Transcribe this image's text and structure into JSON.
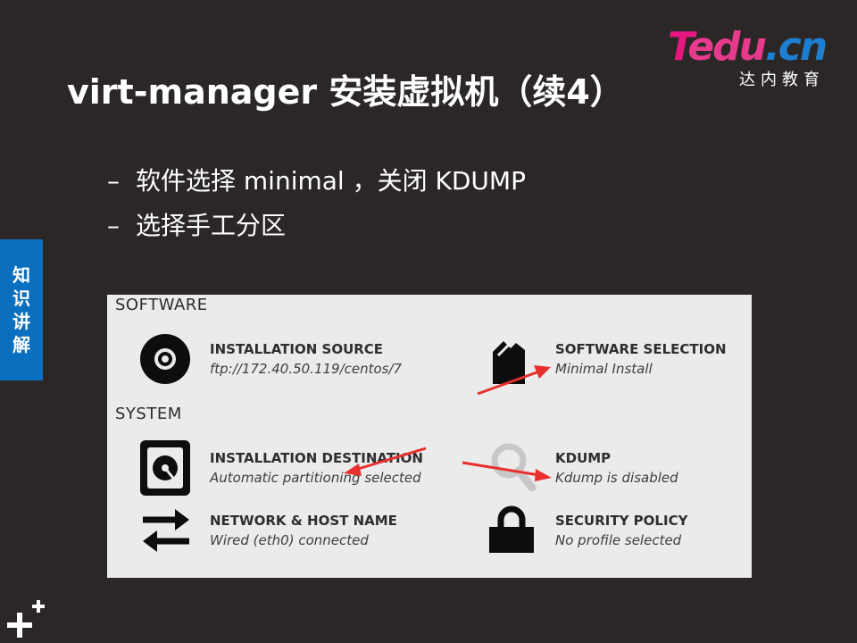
{
  "logo": {
    "brand_part1": "T",
    "brand_part2": "edu",
    "brand_part3": ".cn",
    "subtitle": "达内教育"
  },
  "slide": {
    "title": "virt-manager 安装虚拟机（续4）",
    "bullets": [
      "软件选择 minimal ，关闭 KDUMP",
      "选择手工分区"
    ],
    "bullet_marker": "–",
    "side_tab": [
      "知",
      "识",
      "讲",
      "解"
    ]
  },
  "installer": {
    "software_section": "SOFTWARE",
    "system_section": "SYSTEM",
    "spokes": {
      "installation_source": {
        "name": "INSTALLATION SOURCE",
        "status": "ftp://172.40.50.119/centos/7",
        "icon": "disc-icon"
      },
      "software_selection": {
        "name": "SOFTWARE SELECTION",
        "status": "Minimal Install",
        "icon": "package-icon"
      },
      "installation_destination": {
        "name": "INSTALLATION DESTINATION",
        "status": "Automatic partitioning selected",
        "icon": "harddisk-icon"
      },
      "kdump": {
        "name": "KDUMP",
        "status": "Kdump is disabled",
        "icon": "search-icon"
      },
      "network": {
        "name": "NETWORK & HOST NAME",
        "status": "Wired (eth0) connected",
        "icon": "network-arrows-icon"
      },
      "security_policy": {
        "name": "SECURITY POLICY",
        "status": "No profile selected",
        "icon": "lock-icon"
      }
    }
  },
  "colors": {
    "background": "#2b2727",
    "panel": "#ebebeb",
    "side_tab": "#0b6fc0",
    "annotation_arrow": "#e8312f",
    "logo_pink": "#e8177f",
    "logo_blue": "#1d7fd1"
  }
}
